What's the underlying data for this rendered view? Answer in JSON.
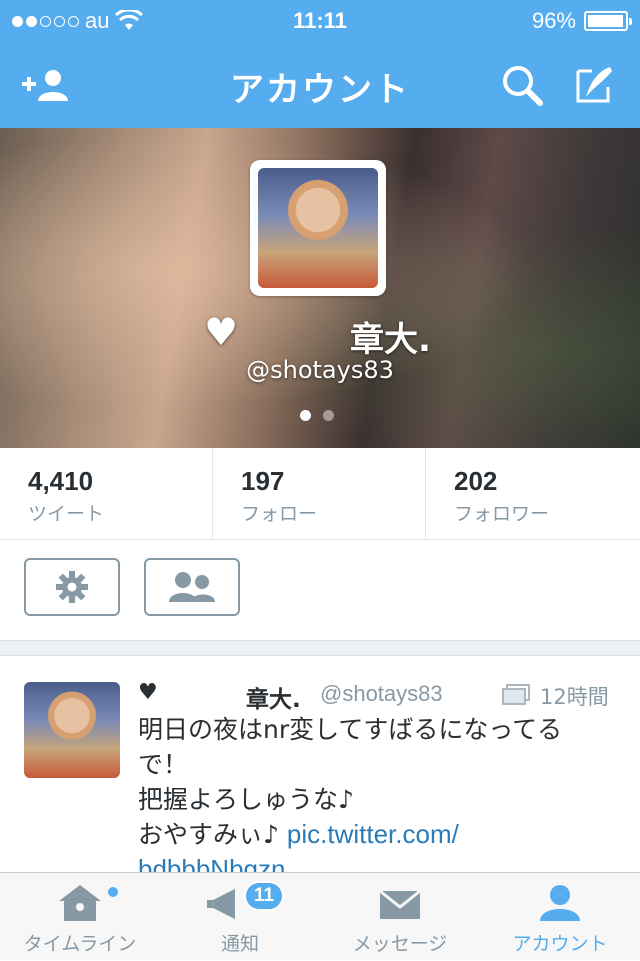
{
  "status_bar": {
    "carrier": "au",
    "signal_bars": 2,
    "signal_total": 5,
    "time": "11:11",
    "battery": "96%",
    "battery_level": 0.96
  },
  "nav": {
    "title": "アカウント"
  },
  "profile": {
    "name": "章大.",
    "heart": "♥",
    "handle": "@shotays83",
    "page_count": 2,
    "page_active": 1
  },
  "stats": [
    {
      "num": "4,410",
      "label": "ツイート"
    },
    {
      "num": "197",
      "label": "フォロー"
    },
    {
      "num": "202",
      "label": "フォロワー"
    }
  ],
  "tweet": {
    "heart": "♥",
    "name": "章大.",
    "handle": "@shotays83",
    "time": "12時間",
    "line1": "明日の夜はnr変してすばるになってる",
    "line2": "で！",
    "line3": "把握よろしゅうな♪",
    "line4": "おやすみぃ♪ ",
    "link1": "pic.twitter.com/",
    "link2": "bdbbbNbgzn"
  },
  "tabs": [
    {
      "label": "タイムライン",
      "icon": "home-icon"
    },
    {
      "label": "通知",
      "icon": "bell-icon",
      "badge": "11"
    },
    {
      "label": "メッセージ",
      "icon": "envelope-icon"
    },
    {
      "label": "アカウント",
      "icon": "person-icon",
      "active": true
    }
  ],
  "colors": {
    "brand": "#55acee",
    "muted": "#8899a6",
    "text": "#292f33",
    "link": "#2b7bb9"
  }
}
